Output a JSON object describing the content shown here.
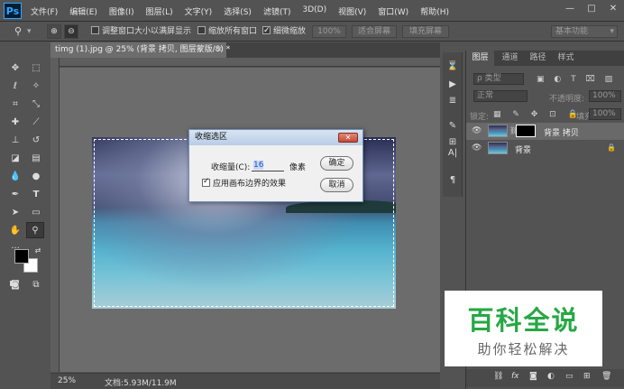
{
  "app": {
    "logo": "Ps"
  },
  "menu": [
    "文件(F)",
    "编辑(E)",
    "图像(I)",
    "图层(L)",
    "文字(Y)",
    "选择(S)",
    "滤镜(T)",
    "3D(D)",
    "视图(V)",
    "窗口(W)",
    "帮助(H)"
  ],
  "window_controls": {
    "minimize": "—",
    "maximize": "□",
    "close": "✕"
  },
  "options_bar": {
    "tool_icon": "zoom-icon",
    "resize_windows": {
      "label": "调整窗口大小以满屏显示",
      "checked": false
    },
    "zoom_all": {
      "label": "缩放所有窗口",
      "checked": false
    },
    "scrubby_zoom": {
      "label": "细微缩放",
      "checked": true
    },
    "zoom_percent": "100%",
    "fit_screen": "适合屏幕",
    "fill_screen": "填充屏幕",
    "workspace": "基本功能"
  },
  "document": {
    "tab_title": "timg (1).jpg @ 25% (背景 拷贝, 图层蒙版/8) *",
    "tab_close": "×",
    "zoom": "25%",
    "doc_size": "文档:5.93M/11.9M"
  },
  "dialog": {
    "title": "收缩选区",
    "close": "✕",
    "amount_label": "收缩量(C):",
    "amount_value": "16",
    "unit": "像素",
    "apply_canvas_bounds": {
      "label": "应用画布边界的效果",
      "checked": true
    },
    "ok": "确定",
    "cancel": "取消"
  },
  "layers_panel": {
    "tabs": [
      "图层",
      "通道",
      "路径",
      "样式"
    ],
    "filter_kind": "ρ 类型",
    "blend_mode": "正常",
    "opacity_label": "不透明度:",
    "opacity_value": "100%",
    "lock_label": "锁定:",
    "fill_label": "填充:",
    "fill_value": "100%",
    "layers": [
      {
        "name": "背景 拷贝",
        "selected": true,
        "has_mask": true,
        "locked": false
      },
      {
        "name": "背景",
        "selected": false,
        "has_mask": false,
        "locked": true
      }
    ],
    "footer_icons": [
      "link-icon",
      "fx-icon",
      "mask-icon",
      "adjustment-icon",
      "group-icon",
      "new-layer-icon",
      "trash-icon"
    ]
  },
  "watermark": {
    "title": "百科全说",
    "subtitle": "助你轻松解决"
  }
}
